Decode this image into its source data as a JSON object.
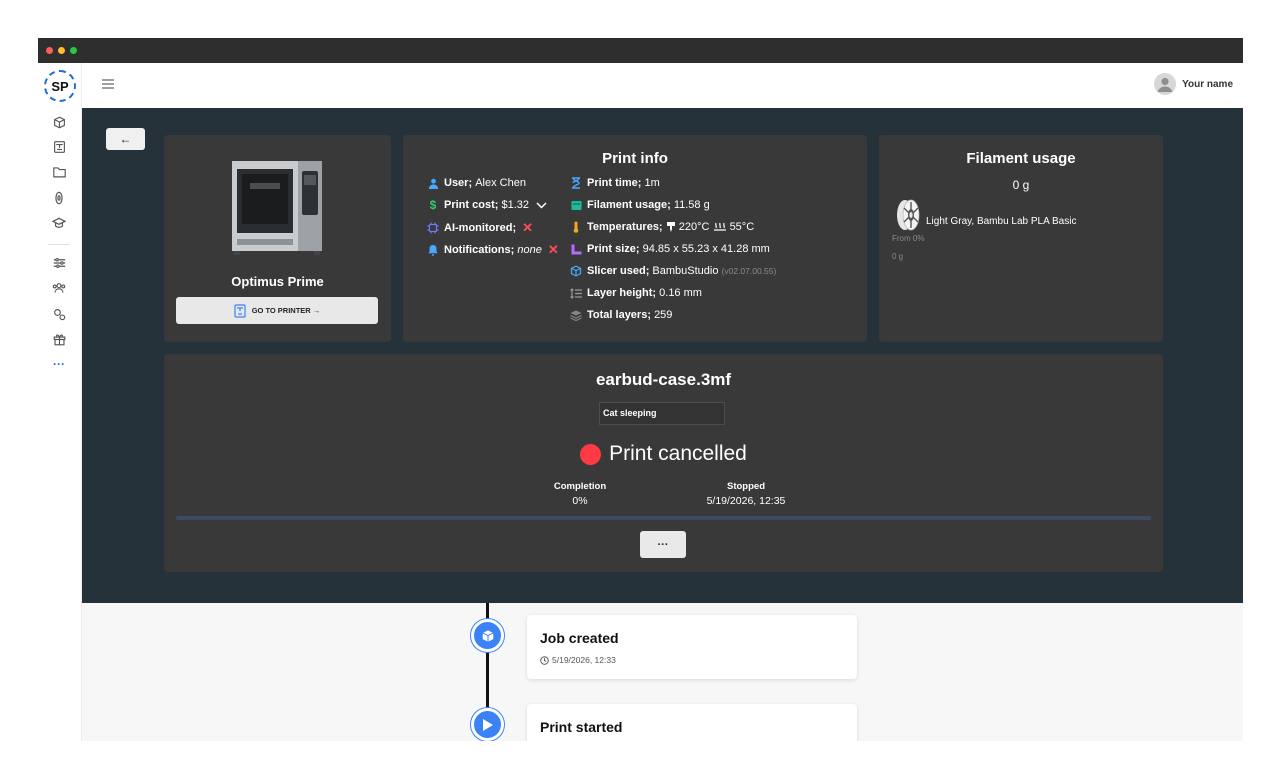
{
  "app": {
    "logo_text": "SP",
    "user_name": "Your name"
  },
  "sidebar": {
    "items": [
      {
        "icon": "cube-icon"
      },
      {
        "icon": "printer-icon"
      },
      {
        "icon": "folder-icon"
      },
      {
        "icon": "filament-icon"
      },
      {
        "icon": "graduation-cap-icon"
      },
      {
        "icon": "sliders-icon"
      },
      {
        "icon": "users-icon"
      },
      {
        "icon": "gears-icon"
      },
      {
        "icon": "gift-icon"
      },
      {
        "icon": "more-icon"
      }
    ],
    "more_label": "···"
  },
  "back_label": "←",
  "printer": {
    "name": "Optimus Prime",
    "go_label": "GO TO PRINTER →"
  },
  "print_info": {
    "title": "Print info",
    "user_label": "User;",
    "user_value": "Alex Chen",
    "cost_label": "Print cost;",
    "cost_value": "$1.32",
    "ai_label": "AI-monitored;",
    "notif_label": "Notifications;",
    "notif_value": "none",
    "time_label": "Print time;",
    "time_value": "1m",
    "filament_label": "Filament usage;",
    "filament_value": "11.58 g",
    "temp_label": "Temperatures;",
    "nozzle_temp": "220°C",
    "bed_temp": "55°C",
    "size_label": "Print size;",
    "size_value": "94.85 x 55.23 x 41.28 mm",
    "slicer_label": "Slicer used;",
    "slicer_value": "BambuStudio",
    "slicer_version": "(v02.07.00.55)",
    "layer_label": "Layer height;",
    "layer_value": "0.16 mm",
    "layers_label": "Total layers;",
    "layers_value": "259"
  },
  "filament": {
    "title": "Filament usage",
    "total": "0 g",
    "name": "Light Gray, Bambu Lab PLA Basic",
    "from": "From 0%",
    "grams": "0 g"
  },
  "job": {
    "filename": "earbud-case.3mf",
    "camera_label": "Cat sleeping",
    "status": "Print cancelled",
    "status_color": "#ff3a45",
    "completion_label": "Completion",
    "completion_value": "0%",
    "progress": 0,
    "stopped_label": "Stopped",
    "stopped_value": "5/19/2026, 12:35",
    "more_label": "···"
  },
  "timeline": [
    {
      "title": "Job created",
      "time": "5/19/2026, 12:33"
    },
    {
      "title": "Print started",
      "time": ""
    }
  ]
}
